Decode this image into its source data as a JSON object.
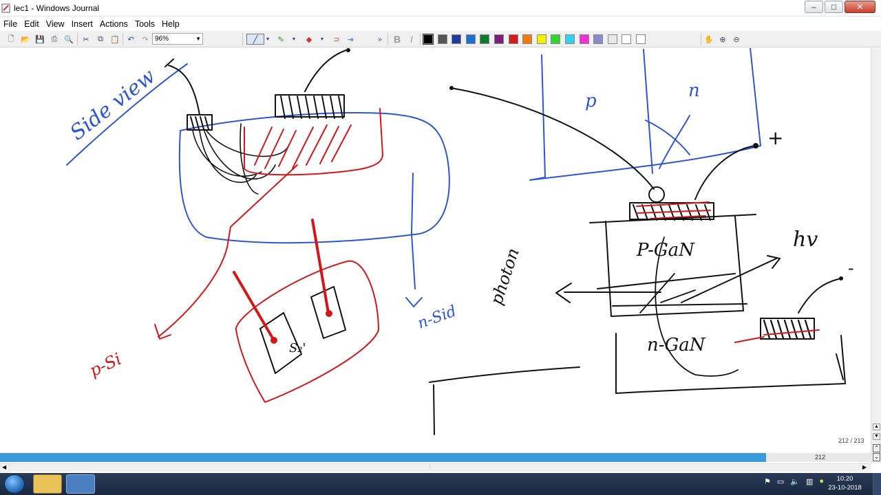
{
  "window": {
    "title": "lec1 - Windows Journal",
    "minimize": "–",
    "maximize": "□",
    "close": "✕"
  },
  "menu": [
    "File",
    "Edit",
    "View",
    "Insert",
    "Actions",
    "Tools",
    "Help"
  ],
  "toolbar": {
    "zoom_value": "96%",
    "bold_label": "B",
    "italic_label": "I",
    "overflow": "»",
    "colors": [
      "#000000",
      "#555555",
      "#1f3c9c",
      "#1f6fcf",
      "#117a2e",
      "#7a1f7a",
      "#d11c1c",
      "#ee7a10",
      "#f5f000",
      "#2bd92b",
      "#2fd2f0",
      "#f02fd2",
      "#8a8ac8",
      "#e8e8e8",
      "#ffffff",
      "#ffffff"
    ]
  },
  "notes": {
    "side_view": "Side view",
    "p_label": "p",
    "n_label": "n",
    "p_gan": "P-GaN",
    "n_gan": "n-GaN",
    "photon": "photon",
    "hv": "hv",
    "n_side": "n-Sid",
    "p_side": "p-Si",
    "sio2": "S₂'",
    "plus": "+",
    "minus": "-"
  },
  "status": {
    "page_indicator": "212 / 213",
    "progress_number": "212",
    "progress_fraction": 0.88
  },
  "taskbar": {
    "time": "10:20",
    "date": "23-10-2018"
  },
  "colors": {
    "ink_black": "#111111",
    "ink_blue": "#2b55d6",
    "ink_red": "#d41616",
    "progress": "#3a9ad9"
  }
}
